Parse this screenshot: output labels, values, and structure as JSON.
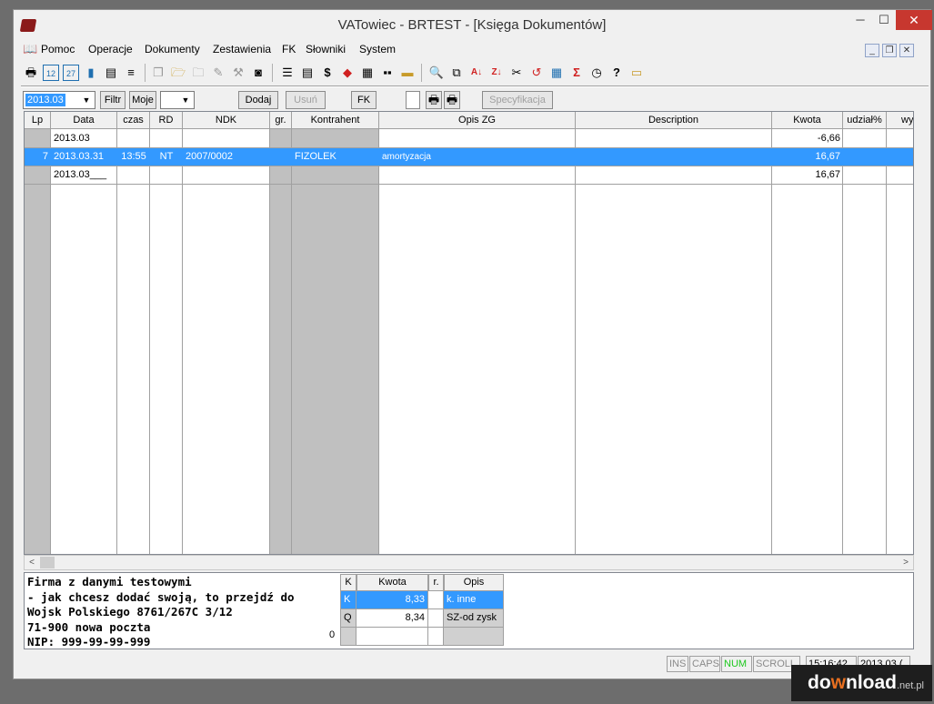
{
  "window": {
    "title": "VATowiec - BRTEST - [Księga Dokumentów]",
    "minimize": "─",
    "maximize": "☐",
    "close": "✕"
  },
  "menu": {
    "items": [
      "Pomoc",
      "Operacje",
      "Dokumenty",
      "Zestawienia",
      "FK",
      "Słowniki",
      "System"
    ]
  },
  "mdi": {
    "min": "_",
    "restore": "❐",
    "close": "✕"
  },
  "toolbar": {
    "icons": [
      "printer-icon",
      "calendar-12-icon",
      "calendar-27-icon",
      "bar-chart-icon",
      "ledger-icon",
      "document-icon",
      "copy-icon",
      "open-folder-icon",
      "folder-icon",
      "pen-icon",
      "magic-wand-icon",
      "camera-icon",
      "list-icon",
      "lines-icon",
      "dollar-icon",
      "fill-icon",
      "text-icon",
      "grid-icon",
      "card-icon",
      "search-icon",
      "find-replace-icon",
      "sort-az-icon",
      "sort-za-icon",
      "scissors-icon",
      "loop-icon",
      "calculator-icon",
      "sigma-icon",
      "clock-icon",
      "help-icon",
      "note-icon"
    ]
  },
  "filter": {
    "period": "2013.03",
    "filtr": "Filtr",
    "moje": "Moje",
    "dodaj": "Dodaj",
    "usun": "Usuń",
    "fk": "FK",
    "specyfikacja": "Specyfikacja"
  },
  "grid": {
    "headers": [
      "Lp",
      "Data",
      "czas",
      "RD",
      "NDK",
      "gr.",
      "Kontrahent",
      "Opis ZG",
      "Description",
      "Kwota",
      "udział%",
      "wy"
    ],
    "rows": [
      {
        "lp": "",
        "data": "2013.03",
        "czas": "",
        "rd": "",
        "ndk": "",
        "gr": "",
        "kontrahent": "",
        "opis": "",
        "description": "",
        "kwota": "-6,66",
        "udzial": ""
      },
      {
        "lp": "7",
        "data": "2013.03.31",
        "czas": "13:55",
        "rd": "NT",
        "ndk": "2007/0002",
        "gr": "",
        "kontrahent": "FIZOLEK",
        "opis": "amortyzacja",
        "description": "",
        "kwota": "16,67",
        "udzial": ""
      },
      {
        "lp": "",
        "data": "2013.03___",
        "czas": "",
        "rd": "",
        "ndk": "",
        "gr": "",
        "kontrahent": "",
        "opis": "",
        "description": "",
        "kwota": "16,67",
        "udzial": ""
      }
    ]
  },
  "scroll": {
    "left": "<",
    "right": ">"
  },
  "info": {
    "lines": [
      "Firma z danymi testowymi",
      "- jak chcesz dodać swoją, to przejdź do",
      "Wojsk Polskiego 8761/267C 3/12",
      "71-900 nowa poczta",
      "NIP: 999-99-99-999"
    ],
    "zero": "0"
  },
  "mini": {
    "headers": [
      "K",
      "Kwota",
      "r.",
      "Opis"
    ],
    "rows": [
      {
        "k": "K",
        "kwota": "8,33",
        "r": "",
        "opis": "k. inne"
      },
      {
        "k": "Q",
        "kwota": "8,34",
        "r": "",
        "opis": "SZ-od zysk"
      }
    ]
  },
  "status": {
    "ins": "INS",
    "caps": "CAPS",
    "num": "NUM",
    "scroll": "SCROLL",
    "time": "15:16:42",
    "date": "2013.03.("
  },
  "watermark": {
    "part1": "do",
    "o": "w",
    "part2": "nload",
    "net": ".net.pl"
  },
  "colors": {
    "selection": "#3399ff",
    "close": "#c7372f",
    "num": "#1ec81e"
  }
}
